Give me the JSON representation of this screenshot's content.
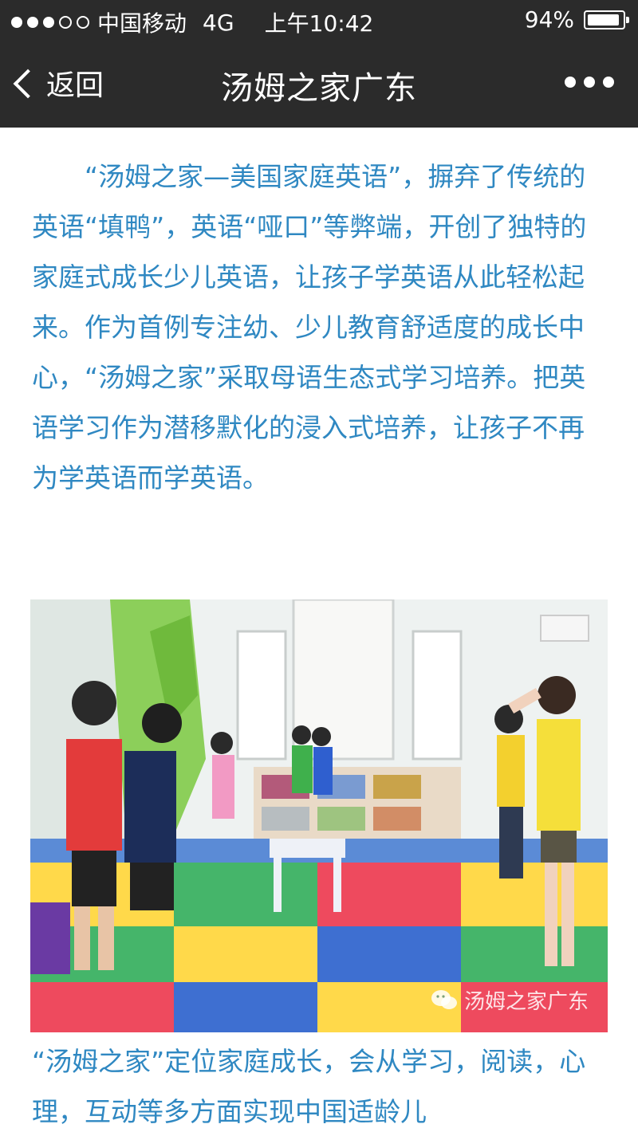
{
  "status_bar": {
    "carrier": "中国移动",
    "network": "4G",
    "time": "上午10:42",
    "battery_percent": "94%",
    "battery_level": 0.94,
    "signal_icon": "signal-dots-icon"
  },
  "nav": {
    "back_label": "返回",
    "title": "汤姆之家广东",
    "more_icon": "more-dots-icon"
  },
  "article": {
    "paragraph1": "“汤姆之家—美国家庭英语”，摒弃了传统的英语“填鸭”，英语“哑口”等弊端，开创了独特的家庭式成长少儿英语，让孩子学英语从此轻松起来。作为首例专注幼、少儿教育舒适度的成长中心，“汤姆之家”采取母语生态式学习培养。把英语学习作为潜移默化的浸入式培养，让孩子不再为学英语而学英语。",
    "photo_watermark": "汤姆之家广东",
    "paragraph2": "“汤姆之家”定位家庭成长，会从学习，阅读，心理，互动等多方面实现中国适龄儿"
  },
  "colors": {
    "header_bg": "#2b2b2b",
    "text_blue": "#2f88c2"
  }
}
